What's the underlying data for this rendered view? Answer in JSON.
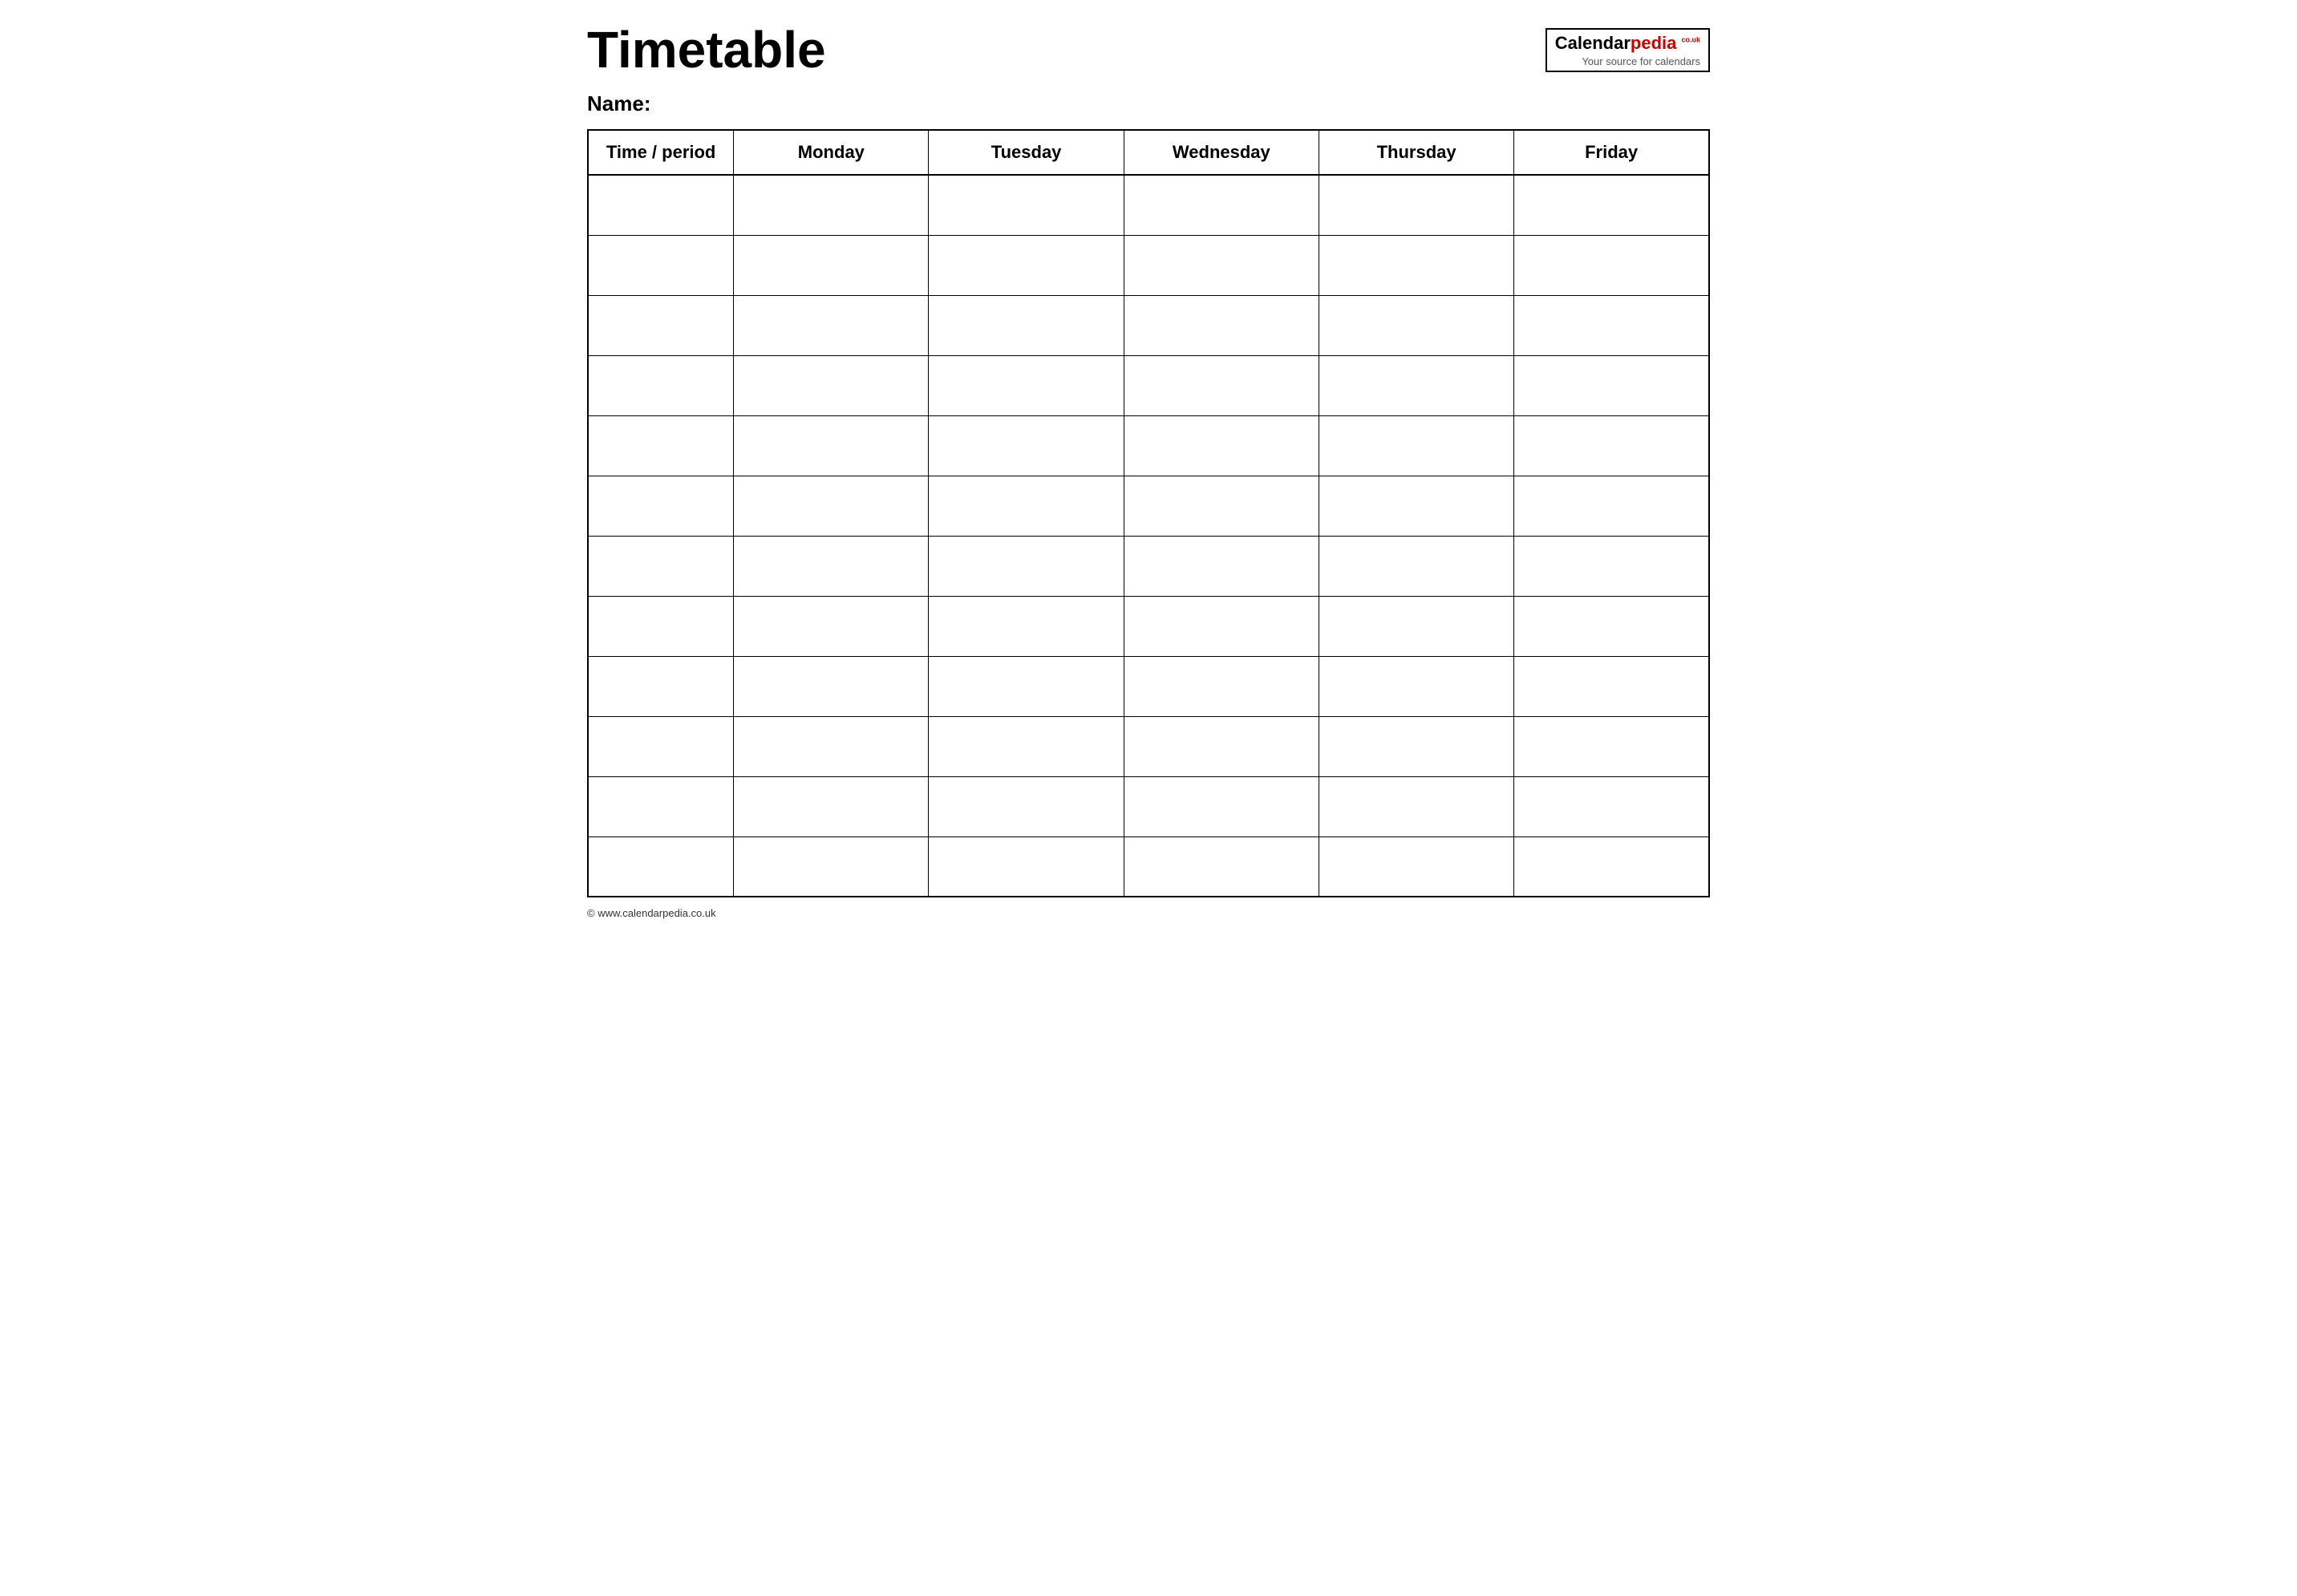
{
  "header": {
    "title": "Timetable",
    "logo": {
      "calendar_text": "Calendar",
      "pedia_text": "pedia",
      "co_uk": "co.uk",
      "subtitle": "Your source for calendars"
    }
  },
  "name_label": "Name:",
  "table": {
    "columns": [
      {
        "label": "Time / period"
      },
      {
        "label": "Monday"
      },
      {
        "label": "Tuesday"
      },
      {
        "label": "Wednesday"
      },
      {
        "label": "Thursday"
      },
      {
        "label": "Friday"
      }
    ],
    "rows": 12
  },
  "footer": {
    "url": "© www.calendarpedia.co.uk"
  }
}
